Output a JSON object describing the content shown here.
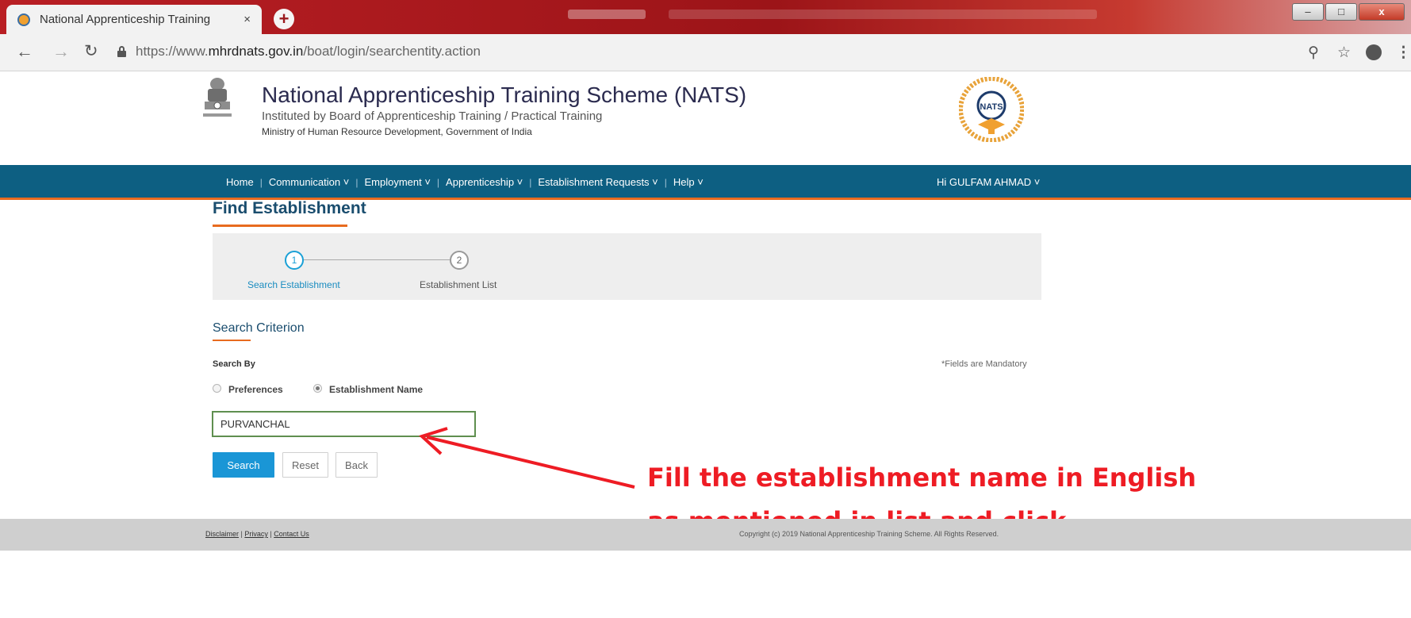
{
  "browser": {
    "tab_title": "National Apprenticeship Training",
    "tab_close": "×",
    "new_tab": "+",
    "url_prefix": "https://www.",
    "url_host": "mhrdnats.gov.in",
    "url_path": "/boat/login/searchentity.action",
    "window_buttons": {
      "minimize": "–",
      "maximize": "□",
      "close": "x"
    }
  },
  "site": {
    "title": "National Apprenticeship Training Scheme (NATS)",
    "subtitle": "Instituted by Board of Apprenticeship Training / Practical Training",
    "ministry": "Ministry of Human Resource Development, Government of India",
    "logo_text": "NATS"
  },
  "nav": {
    "items": [
      "Home",
      "Communication ˅",
      "Employment ˅",
      "Apprenticeship ˅",
      "Establishment Requests ˅",
      "Help ˅"
    ],
    "user": "Hi GULFAM AHMAD ˅"
  },
  "page": {
    "title": "Find Establishment",
    "steps": [
      {
        "number": "1",
        "label": "Search Establishment"
      },
      {
        "number": "2",
        "label": "Establishment List"
      }
    ],
    "section_title": "Search Criterion",
    "search_by_label": "Search By",
    "mandatory_note": "*Fields are Mandatory",
    "radio_options": [
      "Preferences",
      "Establishment Name"
    ],
    "selected_option": "Establishment Name",
    "input_value": "PURVANCHAL",
    "buttons": {
      "search": "Search",
      "reset": "Reset",
      "back": "Back"
    }
  },
  "annotation": {
    "text": "Fill the establishment name in English as mentioned in list and click.",
    "color": "#ee1c24"
  },
  "footer": {
    "links": [
      "Disclaimer",
      "Privacy",
      "Contact Us"
    ],
    "copyright": "Copyright (c) 2019 National Apprenticeship Training Scheme. All Rights Reserved."
  },
  "colors": {
    "nav_bar": "#0d5f82",
    "accent_orange": "#e86b1f",
    "primary_button": "#1a96d6",
    "footer": "#cfcfcf"
  }
}
